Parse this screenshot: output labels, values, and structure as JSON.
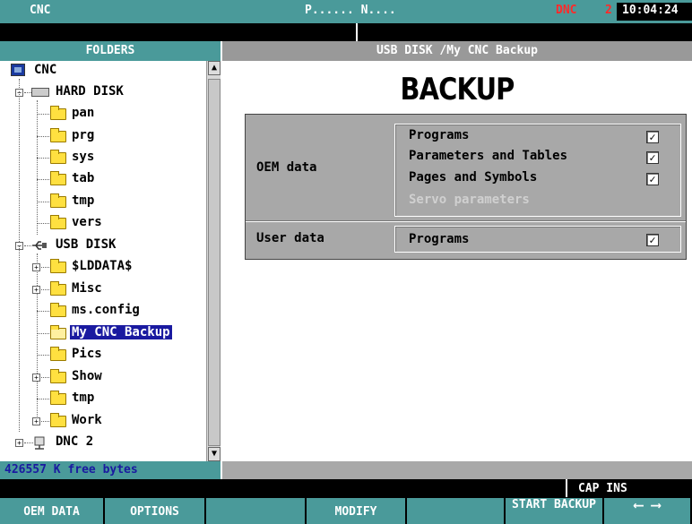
{
  "topbar": {
    "app": "CNC",
    "program": "P...... N....",
    "mode": "DNC",
    "channel": "2",
    "time": "10:04:24"
  },
  "folders_panel": {
    "title": "FOLDERS",
    "items": [
      {
        "label": "CNC"
      },
      {
        "label": "HARD DISK"
      },
      {
        "label": "pan"
      },
      {
        "label": "prg"
      },
      {
        "label": "sys"
      },
      {
        "label": "tab"
      },
      {
        "label": "tmp"
      },
      {
        "label": "vers"
      },
      {
        "label": "USB DISK"
      },
      {
        "label": "$LDDATA$"
      },
      {
        "label": "Misc"
      },
      {
        "label": "ms.config"
      },
      {
        "label": "My CNC Backup"
      },
      {
        "label": "Pics"
      },
      {
        "label": "Show"
      },
      {
        "label": "tmp"
      },
      {
        "label": "Work"
      },
      {
        "label": "DNC 2"
      }
    ],
    "free_space": "426557 K free bytes"
  },
  "main": {
    "path": "USB DISK /My CNC Backup",
    "title": "BACKUP",
    "oem_label": "OEM data",
    "oem_options": [
      {
        "label": "Programs",
        "checked": true
      },
      {
        "label": "Parameters and Tables",
        "checked": true
      },
      {
        "label": "Pages and Symbols",
        "checked": true
      },
      {
        "label": "Servo parameters",
        "enabled": false
      }
    ],
    "user_label": "User data",
    "user_options": [
      {
        "label": "Programs",
        "checked": true
      }
    ],
    "check_mark": "✓"
  },
  "capbar": {
    "status": "CAP  INS"
  },
  "softkeys": [
    {
      "label": "OEM DATA"
    },
    {
      "label": "OPTIONS"
    },
    {
      "label": ""
    },
    {
      "label": "MODIFY"
    },
    {
      "label": ""
    },
    {
      "label": "START BACKUP"
    },
    {
      "label": "⟵ ⟶"
    }
  ]
}
